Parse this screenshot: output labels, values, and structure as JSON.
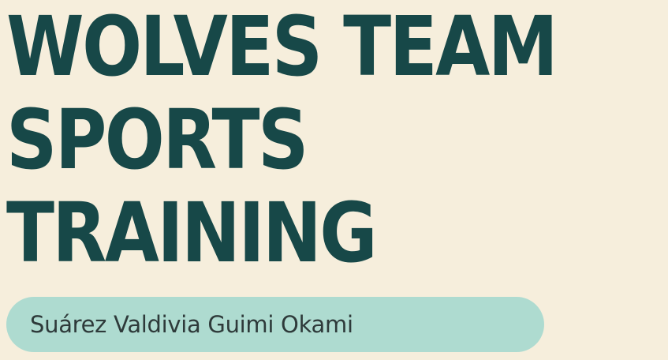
{
  "colors": {
    "background": "#f6eedc",
    "title": "#174848",
    "pill_background": "#aedbd0",
    "pill_text": "#2e3a3a"
  },
  "heading": {
    "lines": [
      "WOLVES TEAM",
      "SPORTS",
      "TRAINING"
    ]
  },
  "author": {
    "name": "Suárez Valdivia Guimi Okami"
  }
}
